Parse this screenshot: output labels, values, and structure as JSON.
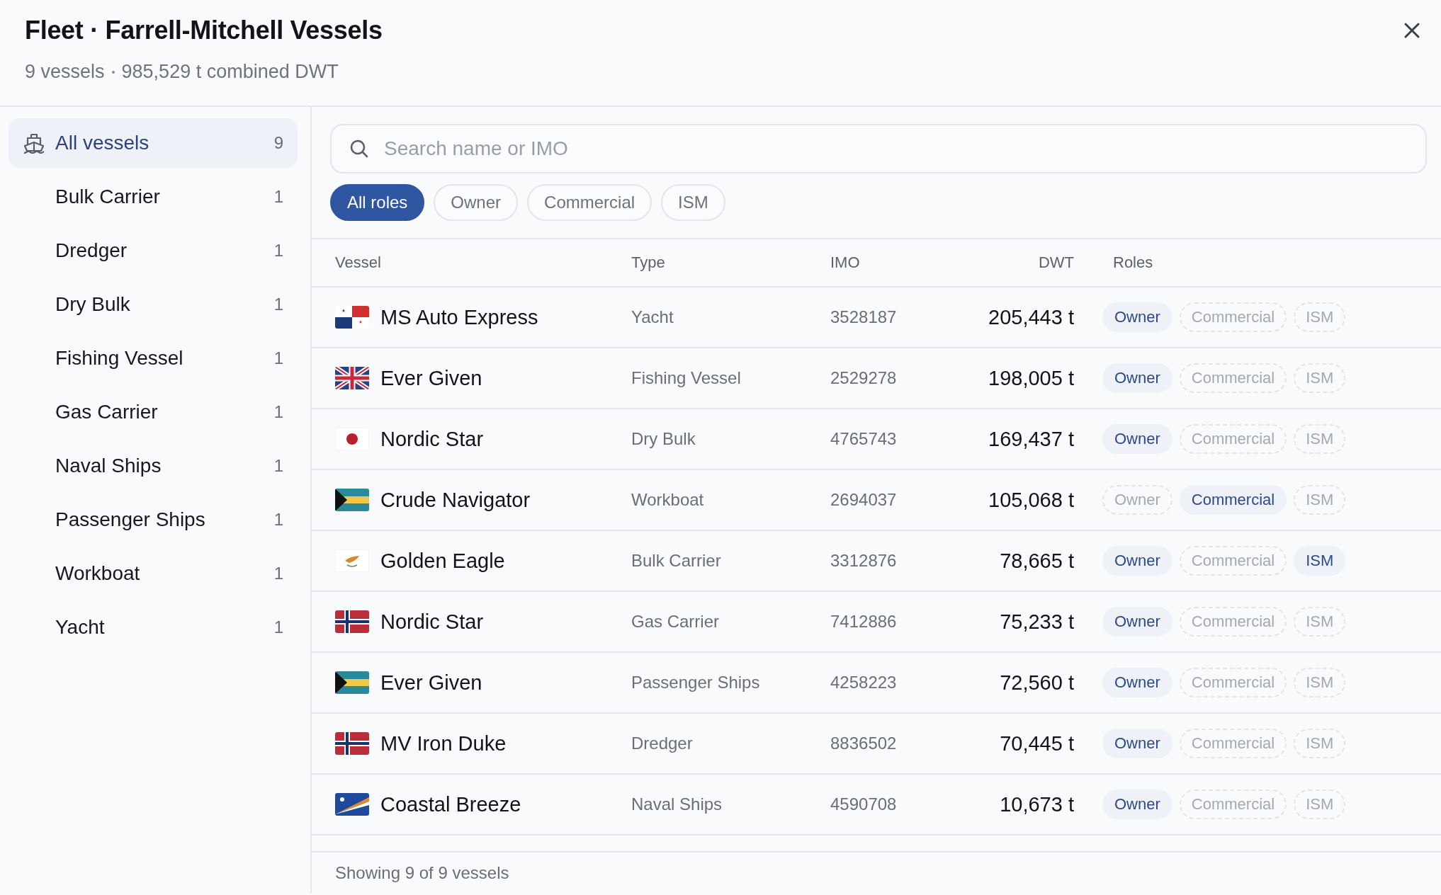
{
  "header": {
    "title": "Fleet · Farrell-Mitchell Vessels",
    "subtitle_count": "9 vessels",
    "subtitle_dwt": "985,529 t combined DWT"
  },
  "sidebar": {
    "items": [
      {
        "label": "All vessels",
        "count": "9",
        "selected": true,
        "kind": "all"
      },
      {
        "label": "Bulk Carrier",
        "count": "1",
        "selected": false,
        "kind": "type"
      },
      {
        "label": "Dredger",
        "count": "1",
        "selected": false,
        "kind": "type"
      },
      {
        "label": "Dry Bulk",
        "count": "1",
        "selected": false,
        "kind": "type"
      },
      {
        "label": "Fishing Vessel",
        "count": "1",
        "selected": false,
        "kind": "type"
      },
      {
        "label": "Gas Carrier",
        "count": "1",
        "selected": false,
        "kind": "type"
      },
      {
        "label": "Naval Ships",
        "count": "1",
        "selected": false,
        "kind": "type"
      },
      {
        "label": "Passenger Ships",
        "count": "1",
        "selected": false,
        "kind": "type"
      },
      {
        "label": "Workboat",
        "count": "1",
        "selected": false,
        "kind": "type"
      },
      {
        "label": "Yacht",
        "count": "1",
        "selected": false,
        "kind": "type"
      }
    ]
  },
  "search": {
    "placeholder": "Search name or IMO"
  },
  "filters": [
    {
      "label": "All roles",
      "selected": true
    },
    {
      "label": "Owner",
      "selected": false
    },
    {
      "label": "Commercial",
      "selected": false
    },
    {
      "label": "ISM",
      "selected": false
    }
  ],
  "table": {
    "columns": [
      "Vessel",
      "Type",
      "IMO",
      "DWT",
      "Roles"
    ],
    "rows": [
      {
        "kind": "panama",
        "vessel": "MS Auto Express",
        "type": "Yacht",
        "imo": "3528187",
        "dwt": "205,443 t",
        "roles": [
          {
            "label": "Owner",
            "selected": true
          },
          {
            "label": "Commercial",
            "selected": false
          },
          {
            "label": "ISM",
            "selected": false
          }
        ]
      },
      {
        "kind": "uk",
        "vessel": "Ever Given",
        "type": "Fishing Vessel",
        "imo": "2529278",
        "dwt": "198,005 t",
        "roles": [
          {
            "label": "Owner",
            "selected": true
          },
          {
            "label": "Commercial",
            "selected": false
          },
          {
            "label": "ISM",
            "selected": false
          }
        ]
      },
      {
        "kind": "japan",
        "vessel": "Nordic Star",
        "type": "Dry Bulk",
        "imo": "4765743",
        "dwt": "169,437 t",
        "roles": [
          {
            "label": "Owner",
            "selected": true
          },
          {
            "label": "Commercial",
            "selected": false
          },
          {
            "label": "ISM",
            "selected": false
          }
        ]
      },
      {
        "kind": "bahamas",
        "vessel": "Crude Navigator",
        "type": "Workboat",
        "imo": "2694037",
        "dwt": "105,068 t",
        "roles": [
          {
            "label": "Owner",
            "selected": false
          },
          {
            "label": "Commercial",
            "selected": true
          },
          {
            "label": "ISM",
            "selected": false
          }
        ]
      },
      {
        "kind": "cyprus",
        "vessel": "Golden Eagle",
        "type": "Bulk Carrier",
        "imo": "3312876",
        "dwt": "78,665 t",
        "roles": [
          {
            "label": "Owner",
            "selected": true
          },
          {
            "label": "Commercial",
            "selected": false
          },
          {
            "label": "ISM",
            "selected": true
          }
        ]
      },
      {
        "kind": "norway",
        "vessel": "Nordic Star",
        "type": "Gas Carrier",
        "imo": "7412886",
        "dwt": "75,233 t",
        "roles": [
          {
            "label": "Owner",
            "selected": true
          },
          {
            "label": "Commercial",
            "selected": false
          },
          {
            "label": "ISM",
            "selected": false
          }
        ]
      },
      {
        "kind": "bahamas",
        "vessel": "Ever Given",
        "type": "Passenger Ships",
        "imo": "4258223",
        "dwt": "72,560 t",
        "roles": [
          {
            "label": "Owner",
            "selected": true
          },
          {
            "label": "Commercial",
            "selected": false
          },
          {
            "label": "ISM",
            "selected": false
          }
        ]
      },
      {
        "kind": "norway",
        "vessel": "MV Iron Duke",
        "type": "Dredger",
        "imo": "8836502",
        "dwt": "70,445 t",
        "roles": [
          {
            "label": "Owner",
            "selected": true
          },
          {
            "label": "Commercial",
            "selected": false
          },
          {
            "label": "ISM",
            "selected": false
          }
        ]
      },
      {
        "kind": "marshall",
        "vessel": "Coastal Breeze",
        "type": "Naval Ships",
        "imo": "4590708",
        "dwt": "10,673 t",
        "roles": [
          {
            "label": "Owner",
            "selected": true
          },
          {
            "label": "Commercial",
            "selected": false
          },
          {
            "label": "ISM",
            "selected": false
          }
        ]
      }
    ]
  },
  "footer": "Showing 9 of 9 vessels"
}
